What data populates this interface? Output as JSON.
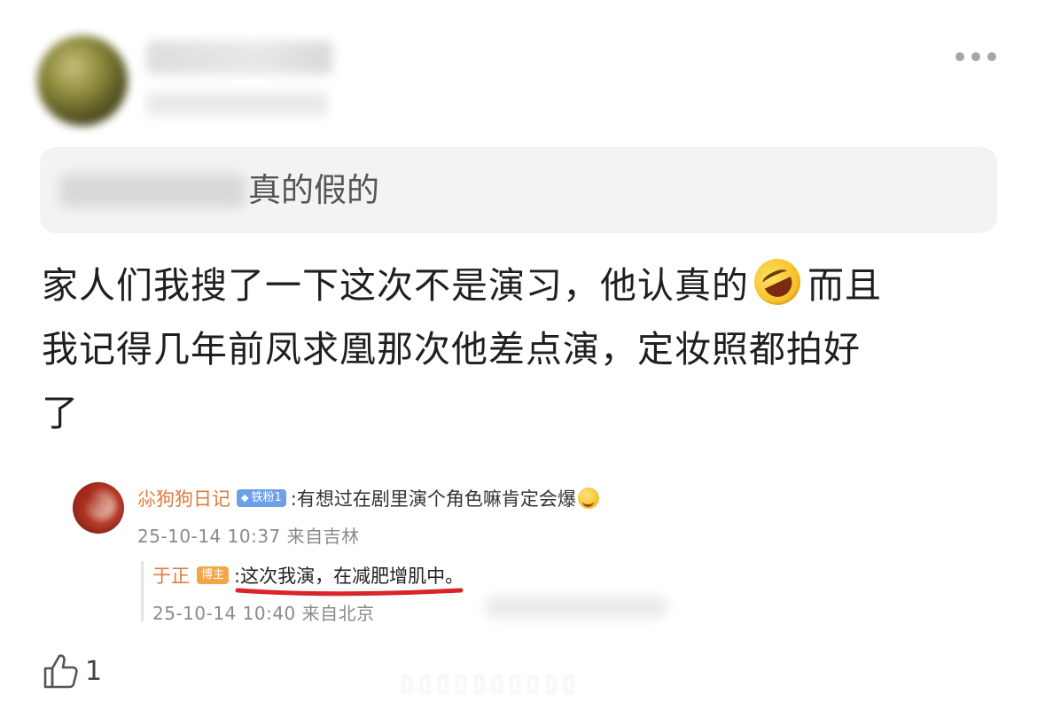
{
  "post": {
    "quote_text": "真的假的",
    "body_line1": "家人们我搜了一下这次不是演习，他认真的",
    "body_line1_tail": "而且",
    "body_line2": "我记得几年前凤求凰那次他差点演，定妆照都拍好",
    "body_line3": "了",
    "emoji_icon": "rolling-on-floor-laughing-emoji"
  },
  "comment": {
    "username": "尛狗狗日记",
    "badge": "铁粉1",
    "text": ":有想过在剧里演个角色嘛肯定会爆",
    "meta": "25-10-14 10:37 来自吉林"
  },
  "reply": {
    "username": "于正",
    "badge": "博主",
    "text": ":这次我演，在减肥增肌中。",
    "meta": "25-10-14 10:40 来自北京",
    "underline_color": "#d8242a"
  },
  "actions": {
    "like_count": "1",
    "more_icon": "ellipsis-icon",
    "like_icon": "thumbs-up-icon"
  },
  "colors": {
    "username": "#e07a3a",
    "fan_badge": "#6ea0e6",
    "host_badge": "#f2a64a",
    "meta": "#8a8a8a"
  }
}
